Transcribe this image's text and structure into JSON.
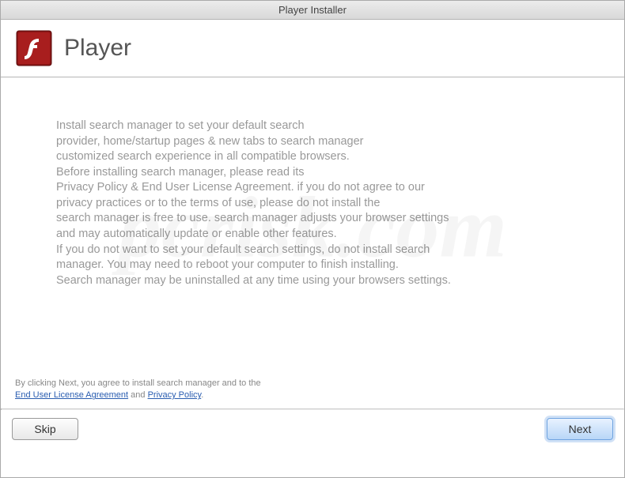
{
  "titlebar": "Player Installer",
  "header": {
    "title": "Player",
    "icon_name": "flash-player-icon"
  },
  "body": {
    "lines": [
      "Install search manager to set your default search",
      "provider, home/startup pages & new tabs to search manager",
      "customized search experience in all compatible browsers.",
      "Before installing search manager, please read its",
      "Privacy Policy & End User License Agreement. if you do not agree to our",
      "privacy practices or to the terms of use, please do not install the",
      "search manager is free to use. search manager adjusts your browser settings",
      "and may automatically update or enable other features.",
      "If you do not want to set your default search settings, do not install search",
      "manager. You may need to reboot your computer to finish installing.",
      "Search manager may be uninstalled at any time using your browsers settings."
    ]
  },
  "footer": {
    "prefix": "By clicking Next, you agree to install search manager and to the",
    "eula_label": "End User License Agreement",
    "and": " and ",
    "privacy_label": "Privacy Policy",
    "suffix": "."
  },
  "buttons": {
    "skip": "Skip",
    "next": "Next"
  },
  "watermark": "pcrisk.com"
}
